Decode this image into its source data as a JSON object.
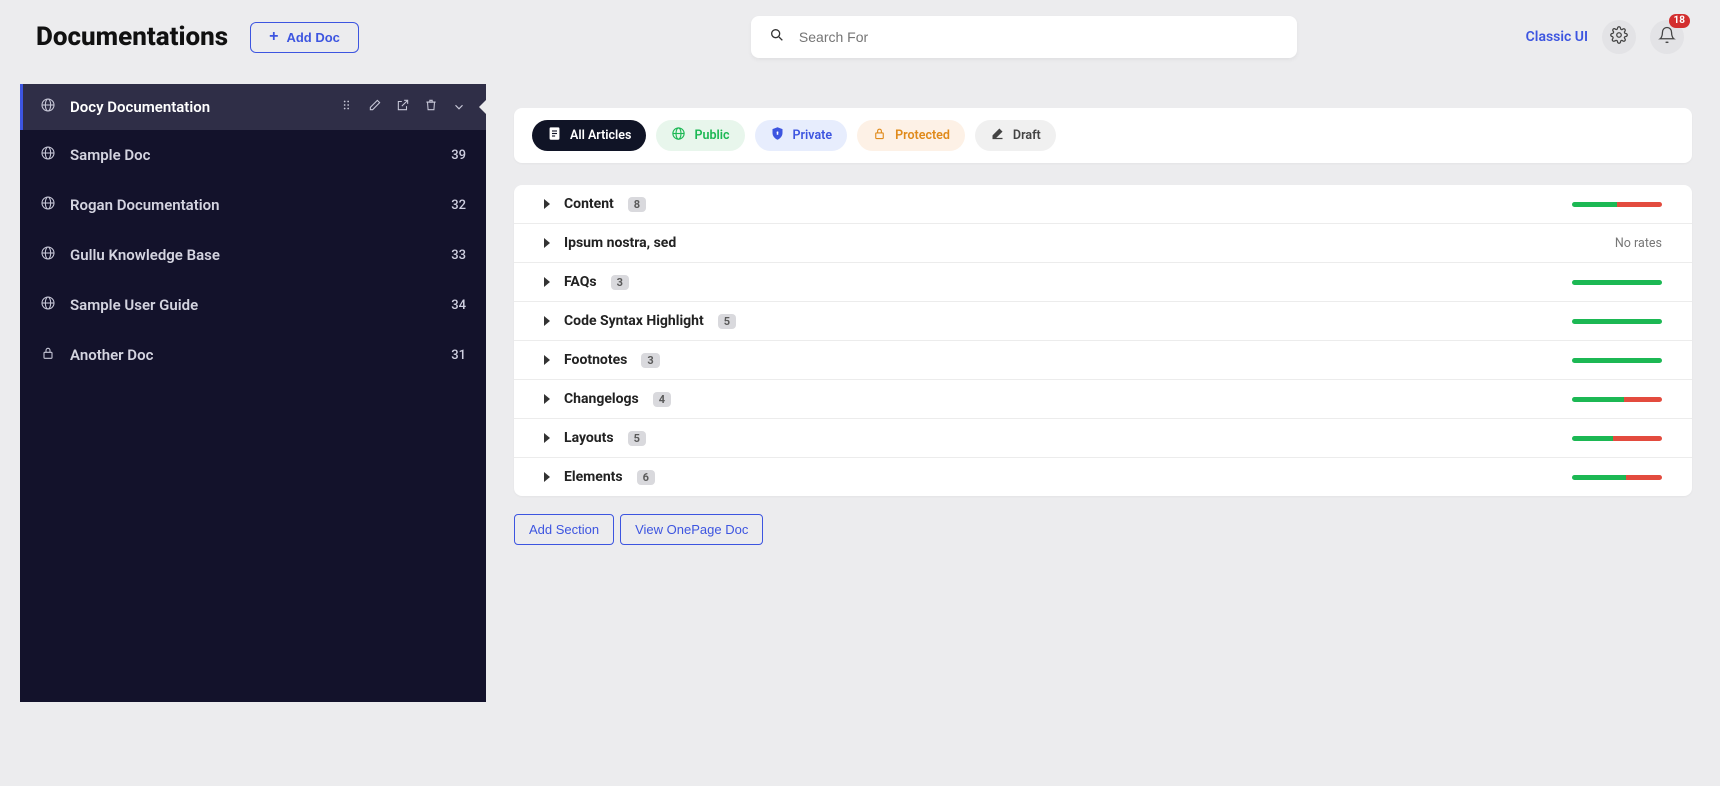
{
  "header": {
    "title": "Documentations",
    "add_doc_label": "Add Doc",
    "search_placeholder": "Search For",
    "classic_ui_label": "Classic UI",
    "notification_count": "18"
  },
  "sidebar": {
    "items": [
      {
        "label": "Docy Documentation",
        "icon": "globe"
      },
      {
        "label": "Sample Doc",
        "icon": "globe",
        "count": "39"
      },
      {
        "label": "Rogan Documentation",
        "icon": "globe",
        "count": "32"
      },
      {
        "label": "Gullu Knowledge Base",
        "icon": "globe",
        "count": "33"
      },
      {
        "label": "Sample User Guide",
        "icon": "globe",
        "count": "34"
      },
      {
        "label": "Another Doc",
        "icon": "lock",
        "count": "31"
      }
    ]
  },
  "filters": {
    "all": "All Articles",
    "public": "Public",
    "private": "Private",
    "protected": "Protected",
    "draft": "Draft"
  },
  "sections": [
    {
      "title": "Content",
      "count": "8",
      "good": 50,
      "bad": 50
    },
    {
      "title": "Ipsum nostra, sed",
      "no_rates": "No rates"
    },
    {
      "title": "FAQs",
      "count": "3",
      "good": 100,
      "bad": 0
    },
    {
      "title": "Code Syntax Highlight",
      "count": "5",
      "good": 100,
      "bad": 0
    },
    {
      "title": "Footnotes",
      "count": "3",
      "good": 100,
      "bad": 0
    },
    {
      "title": "Changelogs",
      "count": "4",
      "good": 58,
      "bad": 42
    },
    {
      "title": "Layouts",
      "count": "5",
      "good": 45,
      "bad": 55
    },
    {
      "title": "Elements",
      "count": "6",
      "good": 60,
      "bad": 40
    }
  ],
  "actions": {
    "add_section": "Add Section",
    "view_onepage": "View OnePage Doc"
  }
}
